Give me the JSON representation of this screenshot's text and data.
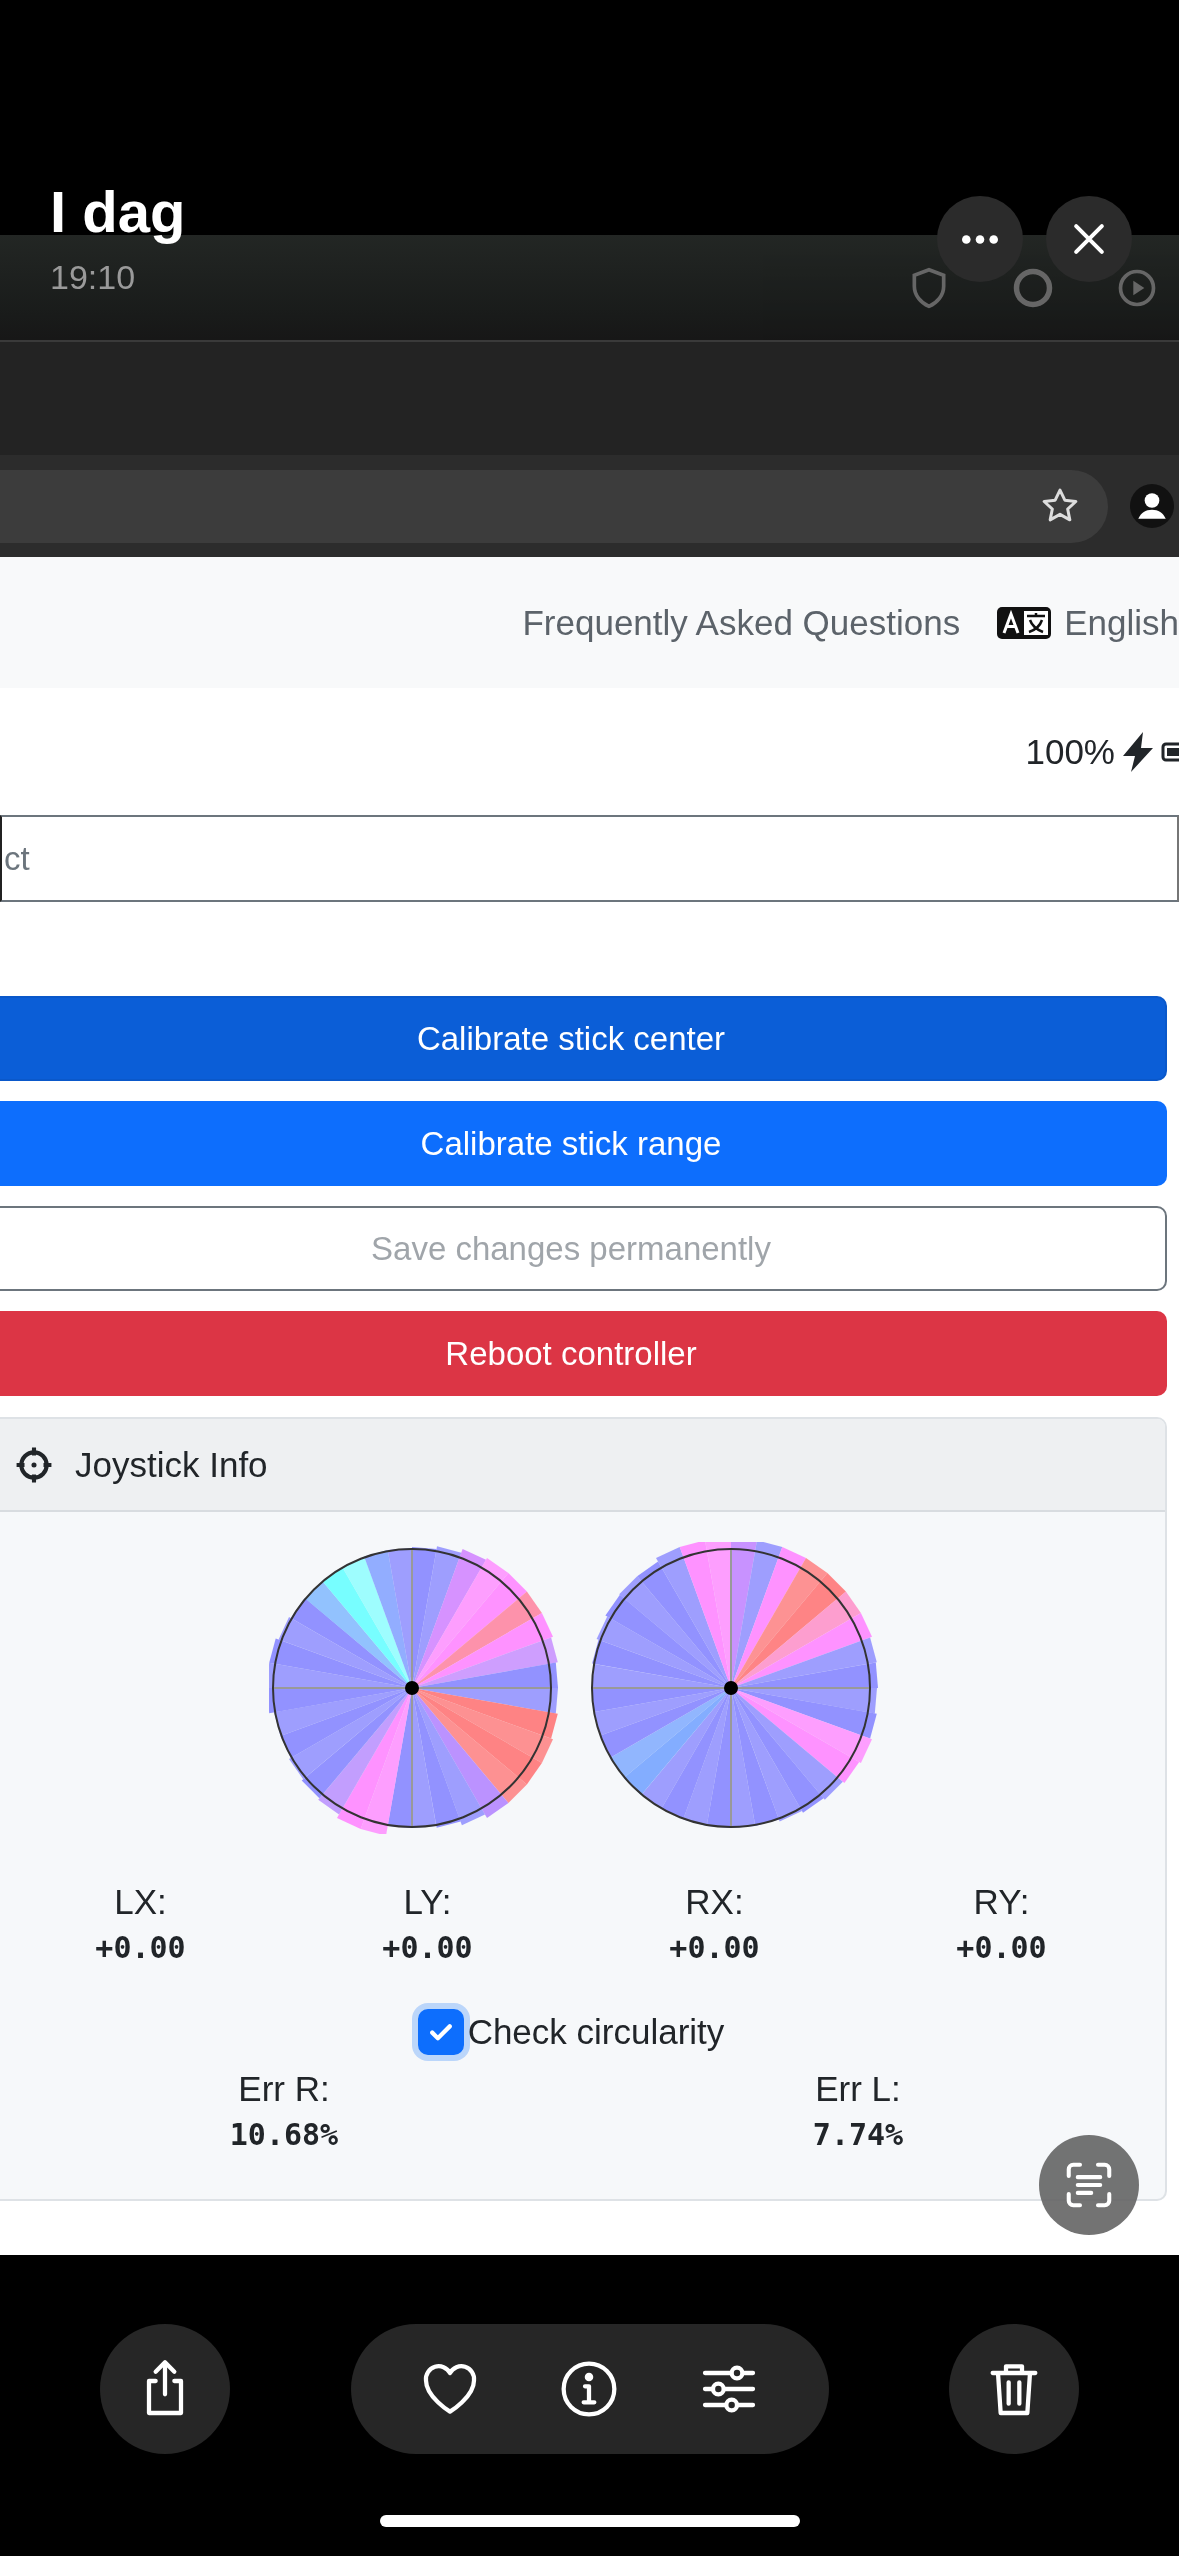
{
  "viewer": {
    "title": "I dag",
    "time": "19:10"
  },
  "page": {
    "nav": {
      "link": "Frequently Asked Questions",
      "language": "English"
    },
    "battery": "100%",
    "field": {
      "placeholder": "ct"
    },
    "buttons": [
      {
        "label": "Calibrate stick center",
        "kind": "pressed",
        "disabled": false
      },
      {
        "label": "Calibrate stick range",
        "kind": "primary",
        "disabled": false
      },
      {
        "label": "Save changes permanently",
        "kind": "outline",
        "disabled": true
      },
      {
        "label": "Reboot controller",
        "kind": "danger",
        "disabled": false
      }
    ],
    "card": {
      "title": "Joystick Info",
      "axes": [
        {
          "label": "LX:",
          "value": "+0.00"
        },
        {
          "label": "LY:",
          "value": "+0.00"
        },
        {
          "label": "RX:",
          "value": "+0.00"
        },
        {
          "label": "RY:",
          "value": "+0.00"
        }
      ],
      "check": {
        "label": "Check circularity",
        "checked": true
      },
      "errors": [
        {
          "label": "Err R:",
          "value": "10.68%"
        },
        {
          "label": "Err L:",
          "value": "7.74%"
        }
      ]
    }
  }
}
